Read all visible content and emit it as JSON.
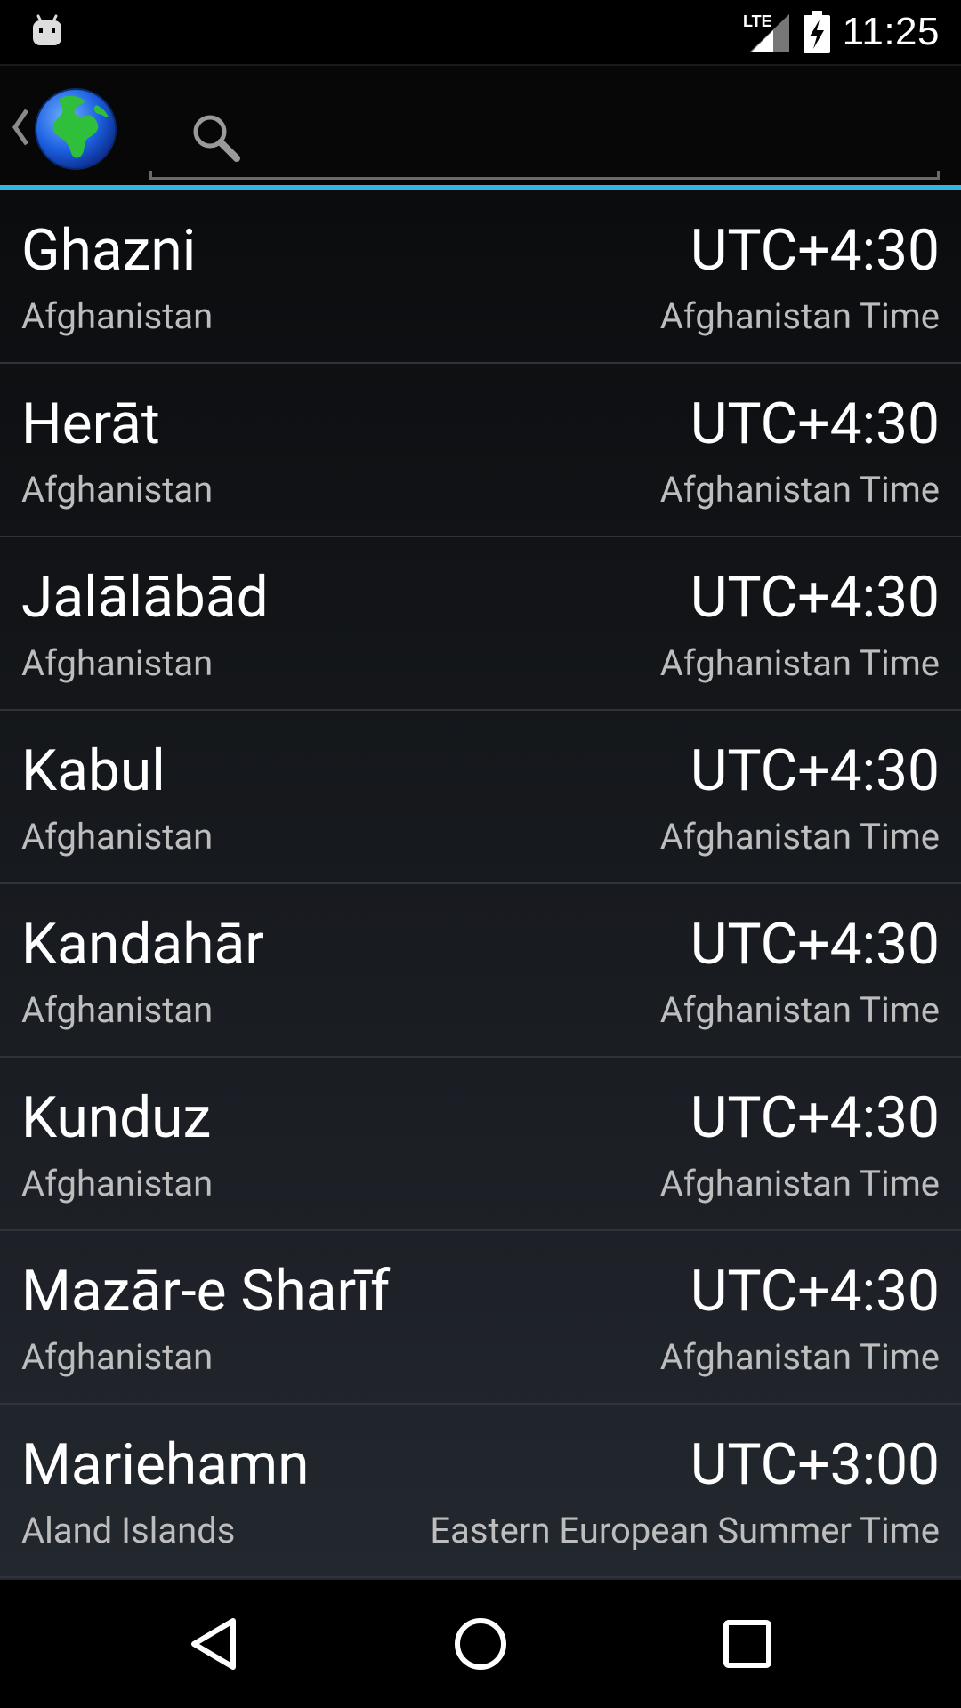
{
  "status_bar": {
    "time": "11:25",
    "network": "LTE",
    "icons": [
      "android-notification-icon",
      "lte-signal-icon",
      "battery-charging-icon"
    ]
  },
  "action_bar": {
    "app_icon": "globe-icon",
    "search": {
      "placeholder": "",
      "value": ""
    }
  },
  "colors": {
    "accent": "#33b5e5",
    "primary_text": "#ffffff",
    "secondary_text": "#bdbdbd"
  },
  "timezones": [
    {
      "city": "Ghazni",
      "country": "Afghanistan",
      "offset": "UTC+4:30",
      "tz_name": "Afghanistan Time"
    },
    {
      "city": "Herāt",
      "country": "Afghanistan",
      "offset": "UTC+4:30",
      "tz_name": "Afghanistan Time"
    },
    {
      "city": "Jalālābād",
      "country": "Afghanistan",
      "offset": "UTC+4:30",
      "tz_name": "Afghanistan Time"
    },
    {
      "city": "Kabul",
      "country": "Afghanistan",
      "offset": "UTC+4:30",
      "tz_name": "Afghanistan Time"
    },
    {
      "city": "Kandahār",
      "country": "Afghanistan",
      "offset": "UTC+4:30",
      "tz_name": "Afghanistan Time"
    },
    {
      "city": "Kunduz",
      "country": "Afghanistan",
      "offset": "UTC+4:30",
      "tz_name": "Afghanistan Time"
    },
    {
      "city": "Mazār-e Sharīf",
      "country": "Afghanistan",
      "offset": "UTC+4:30",
      "tz_name": "Afghanistan Time"
    },
    {
      "city": "Mariehamn",
      "country": "Aland Islands",
      "offset": "UTC+3:00",
      "tz_name": "Eastern European Summer Time"
    }
  ],
  "nav_bar": {
    "buttons": [
      "back-icon",
      "home-icon",
      "recents-icon"
    ]
  }
}
